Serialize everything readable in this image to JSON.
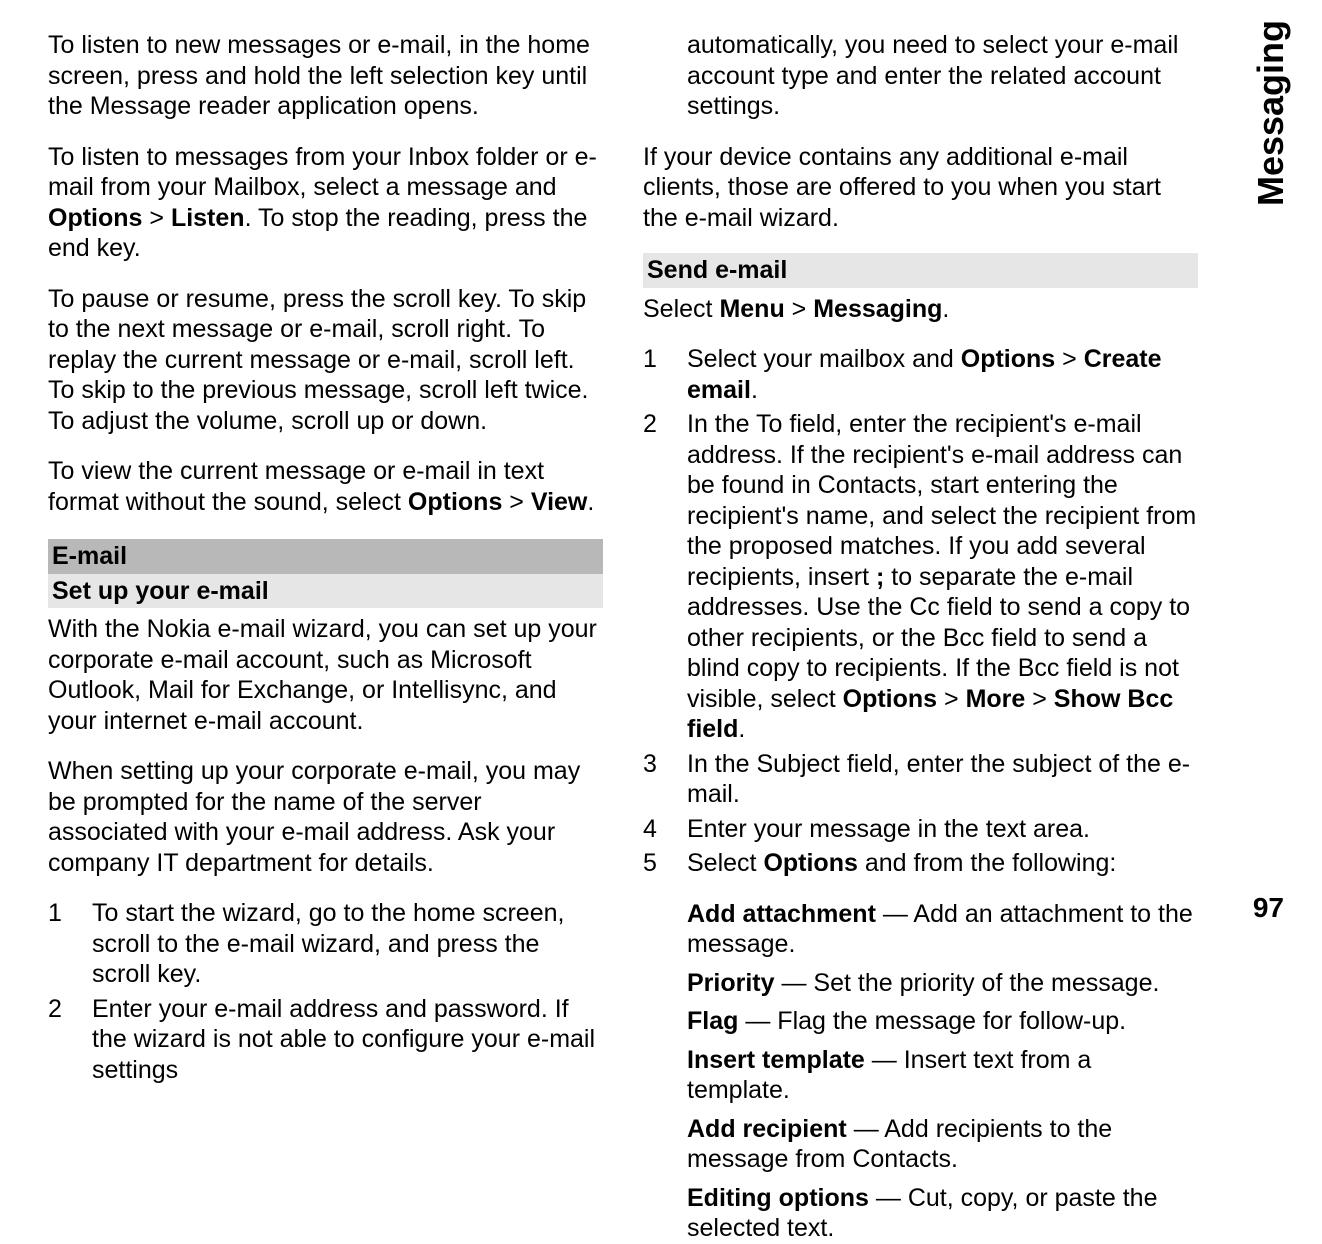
{
  "leftCol": {
    "p1": "To listen to new messages or e-mail, in the home screen, press and hold the left selection key until the Message reader application opens.",
    "p2_pre": "To listen to messages from your Inbox folder or e-mail from your Mailbox, select a message and ",
    "p2_opt": "Options",
    "p2_gt": " > ",
    "p2_listen": "Listen",
    "p2_post": ". To stop the reading, press the end key.",
    "p3": "To pause or resume, press the scroll key. To skip to the next message or e-mail, scroll right. To replay the current message or e-mail, scroll left. To skip to the previous message, scroll left twice. To adjust the volume, scroll up or down.",
    "p4_pre": "To view the current message or e-mail in text format without the sound, select ",
    "p4_opt": "Options",
    "p4_gt": " > ",
    "p4_view": "View",
    "p4_post": ".",
    "email_header": "E-mail",
    "setup_header": "Set up your e-mail",
    "setup_p1": "With the Nokia e-mail wizard, you can set up your corporate e-mail account, such as Microsoft Outlook, Mail for Exchange, or Intellisync, and your internet e-mail account.",
    "setup_p2": "When setting up your corporate e-mail, you may be prompted for the name of the server associated with your e-mail address. Ask your company IT department for details.",
    "steps": {
      "s1": "To start the wizard, go to the home screen, scroll to the e-mail wizard, and press the scroll key.",
      "s2": "Enter your e-mail address and password. If the wizard is not able to configure your e-mail settings"
    }
  },
  "rightCol": {
    "cont": "automatically, you need to select your e-mail account type and enter the related account settings.",
    "p1": "If your device contains any additional e-mail clients, those are offered to you when you start the e-mail wizard.",
    "send_header": "Send e-mail",
    "select_pre": "Select ",
    "menu": "Menu",
    "gt": " > ",
    "messaging": "Messaging",
    "select_post": ".",
    "steps": {
      "s1_pre": "Select your mailbox and ",
      "s1_opt": "Options",
      "s1_gt": " > ",
      "s1_create": "Create email",
      "s1_post": ".",
      "s2_pre": "In the To field, enter the recipient's e-mail address. If the recipient's e-mail address can be found in Contacts, start entering the recipient's name, and select the recipient from the proposed matches. If you add several recipients, insert ",
      "s2_semi": ";",
      "s2_mid": " to separate the e-mail addresses. Use the Cc field to send a copy to other recipients, or the Bcc field to send a blind copy to recipients. If the Bcc field is not visible, select ",
      "s2_opt": "Options",
      "s2_gt1": " > ",
      "s2_more": "More",
      "s2_gt2": " > ",
      "s2_show": "Show Bcc field",
      "s2_post": ".",
      "s3": "In the Subject field, enter the subject of the e-mail.",
      "s4": "Enter your message in the text area.",
      "s5_pre": "Select ",
      "s5_opt": "Options",
      "s5_post": " and from the following:"
    },
    "defs": {
      "d1_t": "Add attachment",
      "d1_b": "  — Add an attachment to the message.",
      "d2_t": "Priority",
      "d2_b": "  — Set the priority of the message.",
      "d3_t": "Flag",
      "d3_b": "  — Flag the message for follow-up.",
      "d4_t": "Insert template",
      "d4_b": "  — Insert text from a template.",
      "d5_t": "Add recipient",
      "d5_b": "  — Add recipients to the message from Contacts.",
      "d6_t": "Editing options",
      "d6_b": "  — Cut, copy, or paste the selected text."
    }
  },
  "sideTab": "Messaging",
  "pageNumber": "97"
}
